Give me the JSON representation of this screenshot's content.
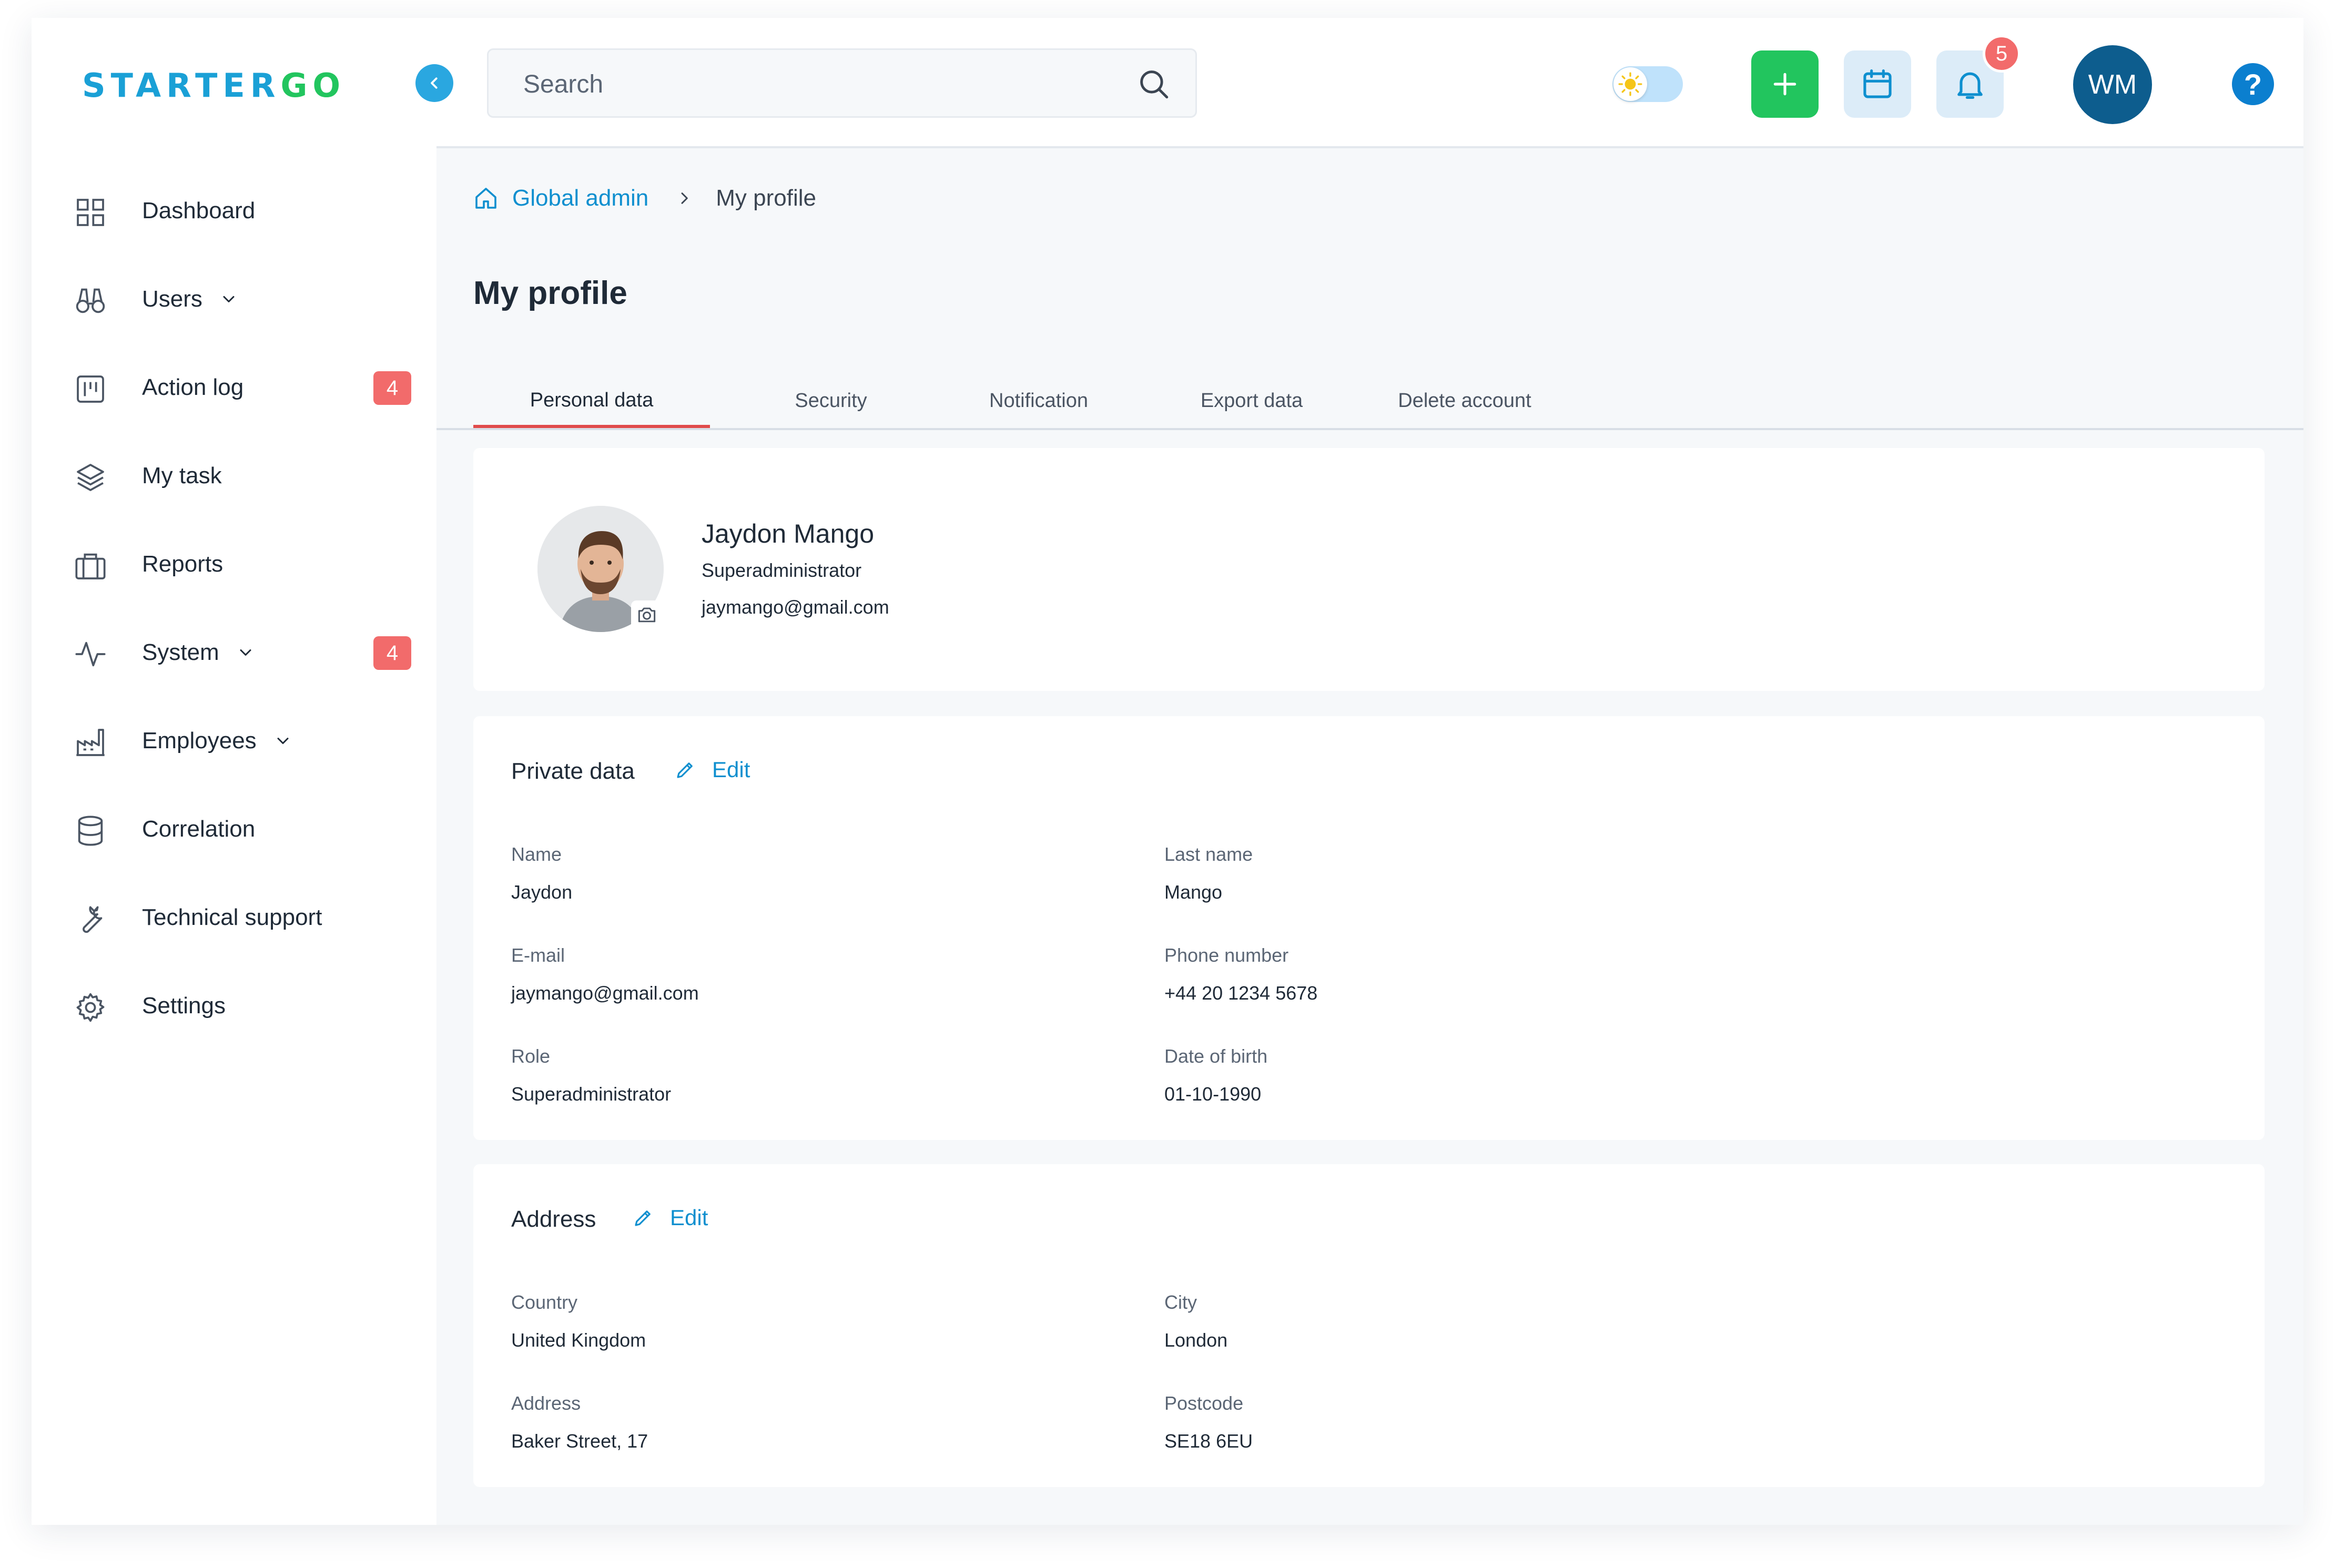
{
  "brand": {
    "logo_main": "STARTER",
    "logo_accent": "GO"
  },
  "search": {
    "placeholder": "Search"
  },
  "header": {
    "notification_count": "5",
    "user_initials": "WM",
    "help_label": "?"
  },
  "sidebar": {
    "items": [
      {
        "label": "Dashboard",
        "icon": "grid-icon"
      },
      {
        "label": "Users",
        "icon": "binoculars-icon",
        "expandable": true
      },
      {
        "label": "Action log",
        "icon": "kanban-icon",
        "badge": "4"
      },
      {
        "label": "My task",
        "icon": "layers-icon"
      },
      {
        "label": "Reports",
        "icon": "briefcase-icon"
      },
      {
        "label": "System",
        "icon": "activity-icon",
        "expandable": true,
        "badge": "4"
      },
      {
        "label": "Employees",
        "icon": "factory-icon",
        "expandable": true
      },
      {
        "label": "Correlation",
        "icon": "database-icon"
      },
      {
        "label": "Technical support",
        "icon": "wrench-icon"
      },
      {
        "label": "Settings",
        "icon": "gear-icon"
      }
    ]
  },
  "breadcrumb": {
    "home": "Global admin",
    "current": "My profile"
  },
  "page": {
    "title": "My profile"
  },
  "tabs": [
    {
      "label": "Personal data",
      "active": true
    },
    {
      "label": "Security"
    },
    {
      "label": "Notification"
    },
    {
      "label": "Export data"
    },
    {
      "label": "Delete account"
    }
  ],
  "profile": {
    "name": "Jaydon Mango",
    "role": "Superadministrator",
    "email": "jaymango@gmail.com"
  },
  "private_data": {
    "title": "Private data",
    "edit_label": "Edit",
    "fields": [
      {
        "label": "Name",
        "value": "Jaydon"
      },
      {
        "label": "Last name",
        "value": "Mango"
      },
      {
        "label": "E-mail",
        "value": "jaymango@gmail.com"
      },
      {
        "label": "Phone number",
        "value": "+44 20 1234 5678"
      },
      {
        "label": "Role",
        "value": "Superadministrator"
      },
      {
        "label": "Date of birth",
        "value": "01-10-1990"
      }
    ]
  },
  "address": {
    "title": "Address",
    "edit_label": "Edit",
    "fields": [
      {
        "label": "Country",
        "value": "United Kingdom"
      },
      {
        "label": "City",
        "value": "London"
      },
      {
        "label": "Address",
        "value": "Baker Street, 17"
      },
      {
        "label": "Postcode",
        "value": "SE18 6EU"
      }
    ]
  },
  "colors": {
    "accent": "#0e8fcf",
    "logo": "#1aa0d6",
    "logo_accent": "#22c55e",
    "add_button": "#22c55e",
    "badge": "#f26b6b",
    "active_tab_underline": "#e04b4b",
    "avatar_bg": "#0d5d8e"
  }
}
